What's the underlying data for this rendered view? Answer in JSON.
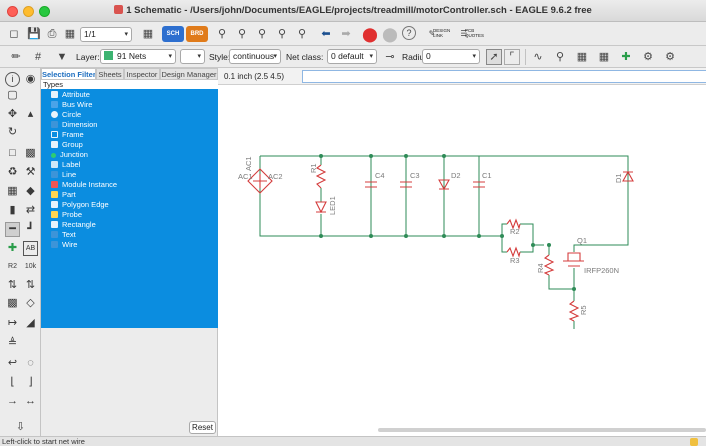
{
  "window": {
    "title": "1 Schematic - /Users/john/Documents/EAGLE/projects/treadmill/motorController.sch - EAGLE 9.6.2 free"
  },
  "toolbar1": {
    "sheet_combo": "1/1",
    "chip_sch": "SCH",
    "chip_brd": "BRD",
    "design_link": "DESIGN LINK",
    "pcb_quotes": "PCB QUOTES",
    "help": "?"
  },
  "toolbar2": {
    "layer_label": "Layer:",
    "layer_value": "91 Nets",
    "layer_color": "#3cb371",
    "style_label": "Style:",
    "style_value": "continuous",
    "netclass_label": "Net class:",
    "netclass_value": "0 default",
    "radius_label": "Radius:",
    "radius_value": "0"
  },
  "panel": {
    "tabs": [
      "Selection Filter",
      "Sheets",
      "Inspector",
      "Design Manager"
    ],
    "types_header": "Types",
    "items": [
      "Attribute",
      "Bus Wire",
      "Circle",
      "Dimension",
      "Frame",
      "Group",
      "Junction",
      "Label",
      "Line",
      "Module Instance",
      "Part",
      "Polygon Edge",
      "Probe",
      "Rectangle",
      "Text",
      "Wire"
    ],
    "reset_label": "Reset",
    "selection_color": "#0b8de0"
  },
  "canvas": {
    "coordinates": "0.1 inch (2.5 4.5)",
    "command_value": "",
    "net_color": "#2e8b57",
    "symbol_color": "#d43c3c"
  },
  "schematic": {
    "labels": [
      "AC1",
      "AC1",
      "AC2",
      "R1",
      "LED1",
      "C4",
      "C3",
      "D2",
      "C1",
      "D1",
      "R2",
      "R3",
      "R4",
      "Q1",
      "IRFP260N",
      "R5"
    ]
  },
  "status": {
    "text": "Left-click to start net wire"
  }
}
